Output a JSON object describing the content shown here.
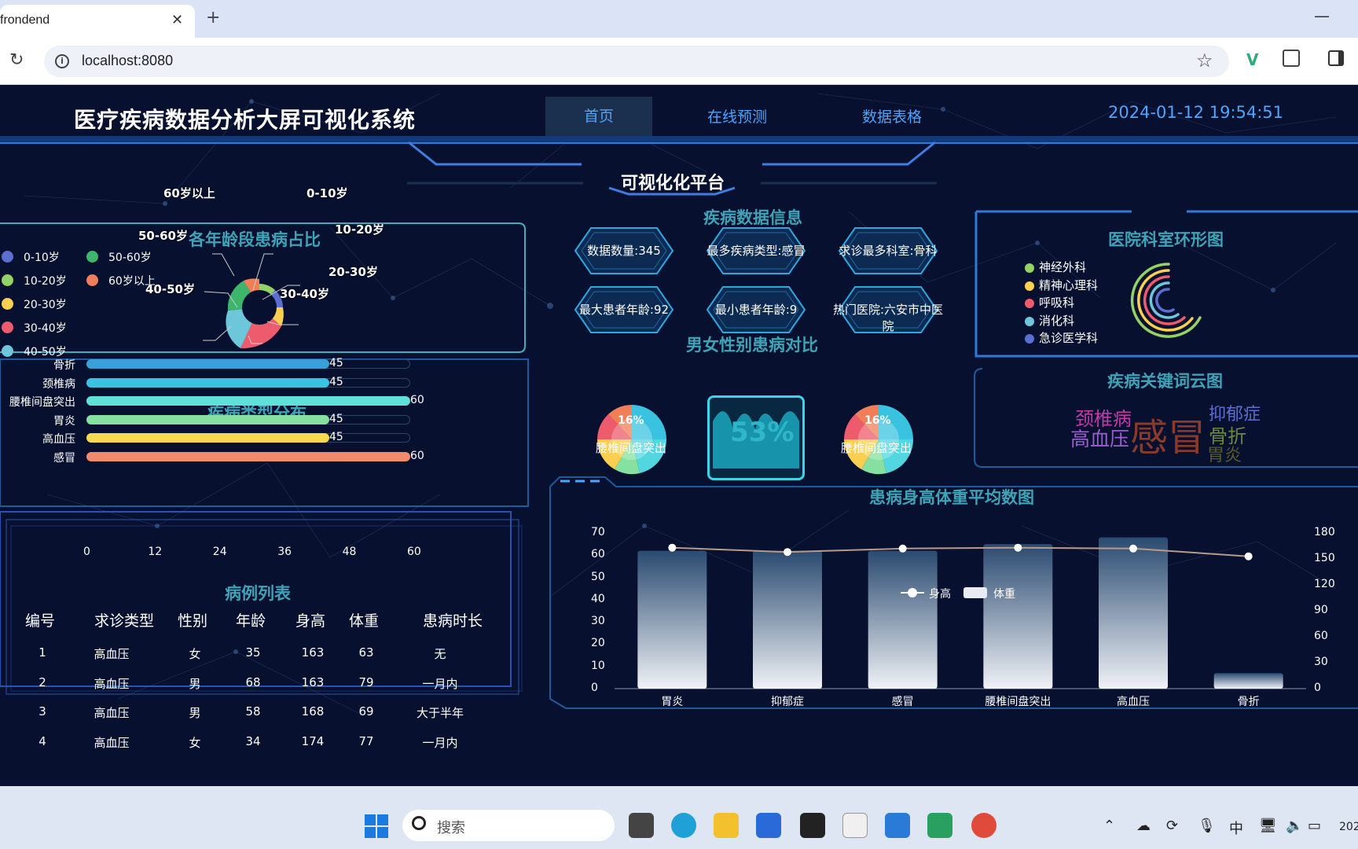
{
  "browser": {
    "tab_title": "frondend",
    "url": "localhost:8080"
  },
  "dashboard": {
    "title": "医疗疾病数据分析大屏可视化系统",
    "nav": [
      "首页",
      "在线预测",
      "数据表格"
    ],
    "datetime": "2024-01-12 19:54:51",
    "platform_title": "可视化化平台"
  },
  "age_panel": {
    "title": "各年龄段患病占比",
    "legend": [
      {
        "label": "0-10岁",
        "color": "#5a6fd0"
      },
      {
        "label": "50-60岁",
        "color": "#3db56b"
      },
      {
        "label": "10-20岁",
        "color": "#93d266"
      },
      {
        "label": "60岁以上",
        "color": "#f07f59"
      },
      {
        "label": "20-30岁",
        "color": "#f8cf4e"
      },
      {
        "label": "30-40岁",
        "color": "#ee5b6d"
      },
      {
        "label": "40-50岁",
        "color": "#6ec6da"
      }
    ],
    "pie_labels": [
      "60岁以上",
      "0-10岁",
      "10-20岁",
      "50-60岁",
      "20-30岁",
      "40-50岁",
      "30-40岁"
    ]
  },
  "info_panel": {
    "title": "疾病数据信息",
    "items": [
      "数据数量:345",
      "最多疾病类型:感冒",
      "求诊最多科室:骨科",
      "最大患者年龄:92",
      "最小患者年龄:9",
      "热门医院:六安市中医院"
    ]
  },
  "gender_panel": {
    "title": "男女性别患病对比",
    "left_pct": "16%",
    "left_label": "腰椎间盘突出",
    "center_pct": "53%",
    "right_pct": "16%",
    "right_label": "腰椎间盘突出"
  },
  "dept_panel": {
    "title": "医院科室环形图",
    "legend": [
      {
        "label": "神经外科",
        "color": "#93d266"
      },
      {
        "label": "精神心理科",
        "color": "#f8cf4e"
      },
      {
        "label": "呼吸科",
        "color": "#ee5b6d"
      },
      {
        "label": "消化科",
        "color": "#6ec6da"
      },
      {
        "label": "急诊医学科",
        "color": "#5a6fd0"
      }
    ]
  },
  "cloud_panel": {
    "title": "疾病关键词云图",
    "words": [
      {
        "text": "颈椎病",
        "color": "#c23aa8"
      },
      {
        "text": "抑郁症",
        "color": "#5a6fd0"
      },
      {
        "text": "高血压",
        "color": "#a15ad6"
      },
      {
        "text": "感冒",
        "color": "#8a3a2a"
      },
      {
        "text": "骨折",
        "color": "#6a8a3a"
      },
      {
        "text": "胃炎",
        "color": "#5a5a2a"
      }
    ]
  },
  "disease_bars": {
    "title": "疾病类型分布",
    "chart_data": {
      "type": "bar",
      "orientation": "horizontal",
      "categories": [
        "骨折",
        "颈椎病",
        "腰椎间盘突出",
        "胃炎",
        "高血压",
        "感冒"
      ],
      "values": [
        45,
        45,
        60,
        45,
        45,
        60
      ],
      "colors": [
        "#3aa0d8",
        "#3ac3e0",
        "#5fe0d8",
        "#86e0a0",
        "#f8d84e",
        "#f08a6a"
      ],
      "xticks": [
        "0",
        "12",
        "24",
        "36",
        "48",
        "60"
      ],
      "xlim": [
        0,
        60
      ]
    }
  },
  "case_table": {
    "title": "病例列表",
    "headers": [
      "编号",
      "求诊类型",
      "性别",
      "年龄",
      "身高",
      "体重",
      "患病时长"
    ],
    "rows": [
      [
        "1",
        "高血压",
        "女",
        "35",
        "163",
        "63",
        "无"
      ],
      [
        "2",
        "高血压",
        "男",
        "68",
        "163",
        "79",
        "一月内"
      ],
      [
        "3",
        "高血压",
        "男",
        "58",
        "168",
        "69",
        "大于半年"
      ],
      [
        "4",
        "高血压",
        "女",
        "34",
        "174",
        "77",
        "一月内"
      ]
    ]
  },
  "hw_chart": {
    "title": "患病身高体重平均数图",
    "chart_data": {
      "type": "bar",
      "categories": [
        "胃炎",
        "抑郁症",
        "感冒",
        "腰椎间盘突出",
        "高血压",
        "骨折"
      ],
      "series": [
        {
          "name": "身高",
          "type": "line",
          "axis": "right",
          "values": [
            163,
            158,
            162,
            163,
            162,
            153
          ]
        },
        {
          "name": "体重",
          "type": "bar",
          "axis": "left",
          "values": [
            62,
            62,
            62,
            65,
            68,
            7
          ]
        }
      ],
      "yticks_left": [
        "70",
        "60",
        "50",
        "40",
        "30",
        "20",
        "10",
        "0"
      ],
      "yticks_right": [
        "180",
        "150",
        "120",
        "90",
        "60",
        "30",
        "0"
      ],
      "ylim_left": [
        0,
        70
      ],
      "ylim_right": [
        0,
        180
      ]
    }
  },
  "taskbar": {
    "search_label": "搜索",
    "ime": "中",
    "clock_partial": "202"
  }
}
